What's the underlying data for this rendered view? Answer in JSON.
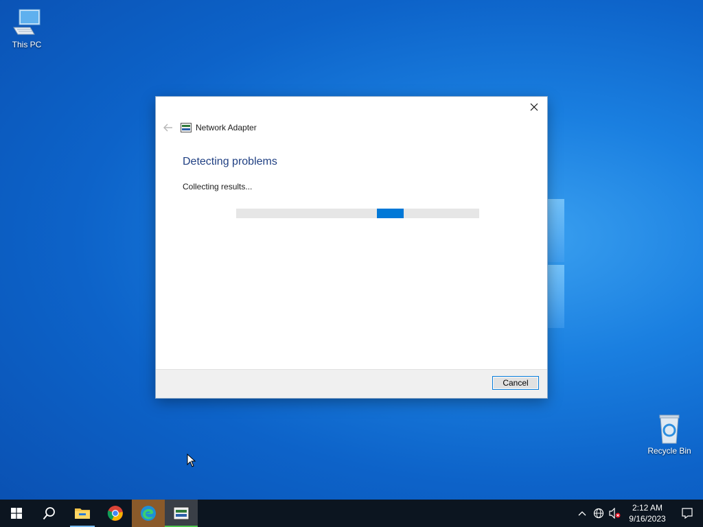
{
  "desktop": {
    "icons": [
      {
        "label": "This PC",
        "icon": "computer-icon"
      },
      {
        "label": "Recycle Bin",
        "icon": "recycle-bin-icon"
      }
    ],
    "accent": "#0a63c9"
  },
  "dialog": {
    "app_title": "Network Adapter",
    "heading": "Detecting problems",
    "status": "Collecting results...",
    "progress_state": "indeterminate",
    "cancel_label": "Cancel",
    "heading_color": "#1f3f82",
    "progress_color": "#0078d7"
  },
  "taskbar": {
    "apps": [
      {
        "name": "start",
        "icon": "windows-start-icon"
      },
      {
        "name": "search",
        "icon": "search-icon"
      },
      {
        "name": "file-explorer",
        "icon": "folder-icon"
      },
      {
        "name": "chrome",
        "icon": "chrome-icon"
      },
      {
        "name": "edge",
        "icon": "edge-icon"
      },
      {
        "name": "network-troubleshooter",
        "icon": "network-adapter-icon"
      }
    ],
    "clock": {
      "time": "2:12 AM",
      "date": "9/16/2023"
    }
  }
}
